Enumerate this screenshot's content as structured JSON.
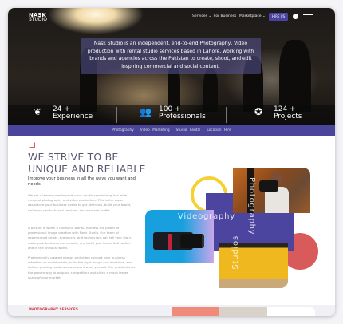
{
  "header": {
    "logo_top": "NASK",
    "logo_bottom": "STUDIO",
    "nav": [
      "Services ⌄",
      "For Business",
      "Marketplace ⌄"
    ],
    "hire": "HIRE US"
  },
  "hero": {
    "intro": "Nask Studio is an independent, end-to-end Photography, Video production with rental studio services based in Lahore, working with brands and agencies across the Pakistan to create, shoot, and edit inspiring commercial and social content.",
    "stats": [
      {
        "num": "24 +",
        "label": "Experience",
        "icon": "laurel-badge-icon"
      },
      {
        "num": "100 +",
        "label": "Professionals",
        "icon": "people-group-icon"
      },
      {
        "num": "124 +",
        "label": "Projects",
        "icon": "award-medal-icon"
      }
    ]
  },
  "subnav": [
    "Photography",
    "Video Marketing",
    "Studio Rental",
    "Location Hire"
  ],
  "about": {
    "title_1": "WE STRIVE TO BE",
    "title_2": "UNIQUE AND RELIABLE",
    "lead": "Improve your business in all the ways you want and needs.",
    "p1": "We are a leading media production studio specializing in a wide range of photography and video production. This is the expert assistance your business needs to get attention, build your brand, sell more products and services, and increase profits.",
    "p2": "A picture is worth a thousand words. Harness the power of professional image creation with Nask Studio. Our team of experienced artists, producers, and technicians can tell your story, make your business memorable, and build your brand both online and in the physical world.",
    "p3": "Professionally created photos and video can get your business attention on social media, build the right image and emotions, and deliver growing audiences who want what you sell. Our production is the proven way to outpace competitors and claim a much larger share of your market."
  },
  "collage": {
    "videography": "Videography",
    "photography": "Photography",
    "studios": "Studios"
  },
  "services": {
    "label": "PHOTOGRAPHY SERVICES"
  },
  "colors": {
    "accent": "#4a449a",
    "red": "#d95a5a",
    "yellow": "#f5d234"
  }
}
